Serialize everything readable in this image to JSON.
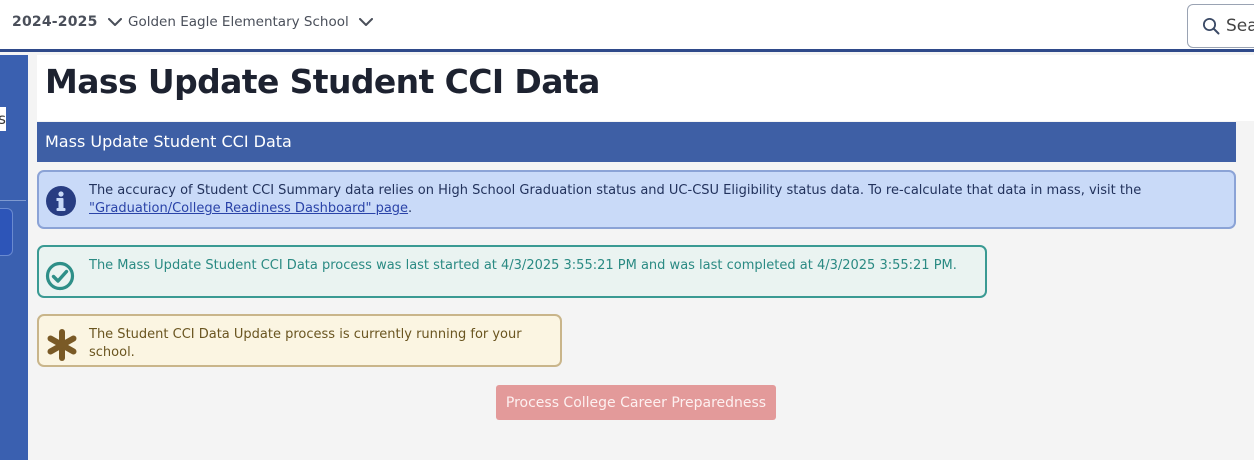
{
  "topbar": {
    "year_label": "2024-2025",
    "school_label": "Golden Eagle Elementary School",
    "search_placeholder": "Sea"
  },
  "sidebar": {
    "partial_text": "s"
  },
  "page": {
    "title": "Mass Update Student CCI Data",
    "panel_title": "Mass Update Student CCI Data"
  },
  "alerts": {
    "info": {
      "text": "The accuracy of Student CCI Summary data relies on High School Graduation status and UC-CSU Eligibility status data. To re-calculate that data in mass, visit the ",
      "link": "\"Graduation/College Readiness Dashboard\" page",
      "suffix": "."
    },
    "success": {
      "text": "The Mass Update Student CCI Data process was last started at 4/3/2025 3:55:21 PM and was last completed at 4/3/2025 3:55:21 PM."
    },
    "warning": {
      "text": "The Student CCI Data Update process is currently running for your school."
    }
  },
  "actions": {
    "process_button": "Process College Career Preparedness"
  },
  "colors": {
    "header_blue": "#3e5fa5",
    "sidebar_blue": "#3a60b0",
    "info_bg": "#c9daf8",
    "success_border": "#3a9a93",
    "warning_border": "#c9b58a",
    "disabled_button": "#e39a9a"
  },
  "icons": {
    "info": "info-circle-icon",
    "success": "check-circle-icon",
    "warning": "asterisk-icon",
    "search": "search-icon",
    "dropdown": "chevron-down-icon"
  }
}
